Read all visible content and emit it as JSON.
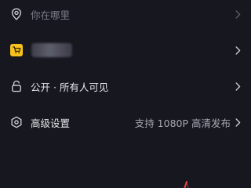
{
  "rows": {
    "location": {
      "label": "你在哪里",
      "icon": "location-pin-icon"
    },
    "shop": {
      "icon": "shopping-cart-icon"
    },
    "visibility": {
      "label": "公开 · 所有人可见",
      "icon": "unlock-icon"
    },
    "advanced": {
      "label": "高级设置",
      "value": "支持 1080P 高清发布",
      "icon": "settings-hexagon-icon"
    }
  },
  "colors": {
    "background": "#16171f",
    "text": "#e6e6ea",
    "muted_text": "#7c7e88",
    "value_text": "#a6a8b0",
    "shop_badge": "#f7c21b",
    "accent_stroke": "#e8453c"
  }
}
